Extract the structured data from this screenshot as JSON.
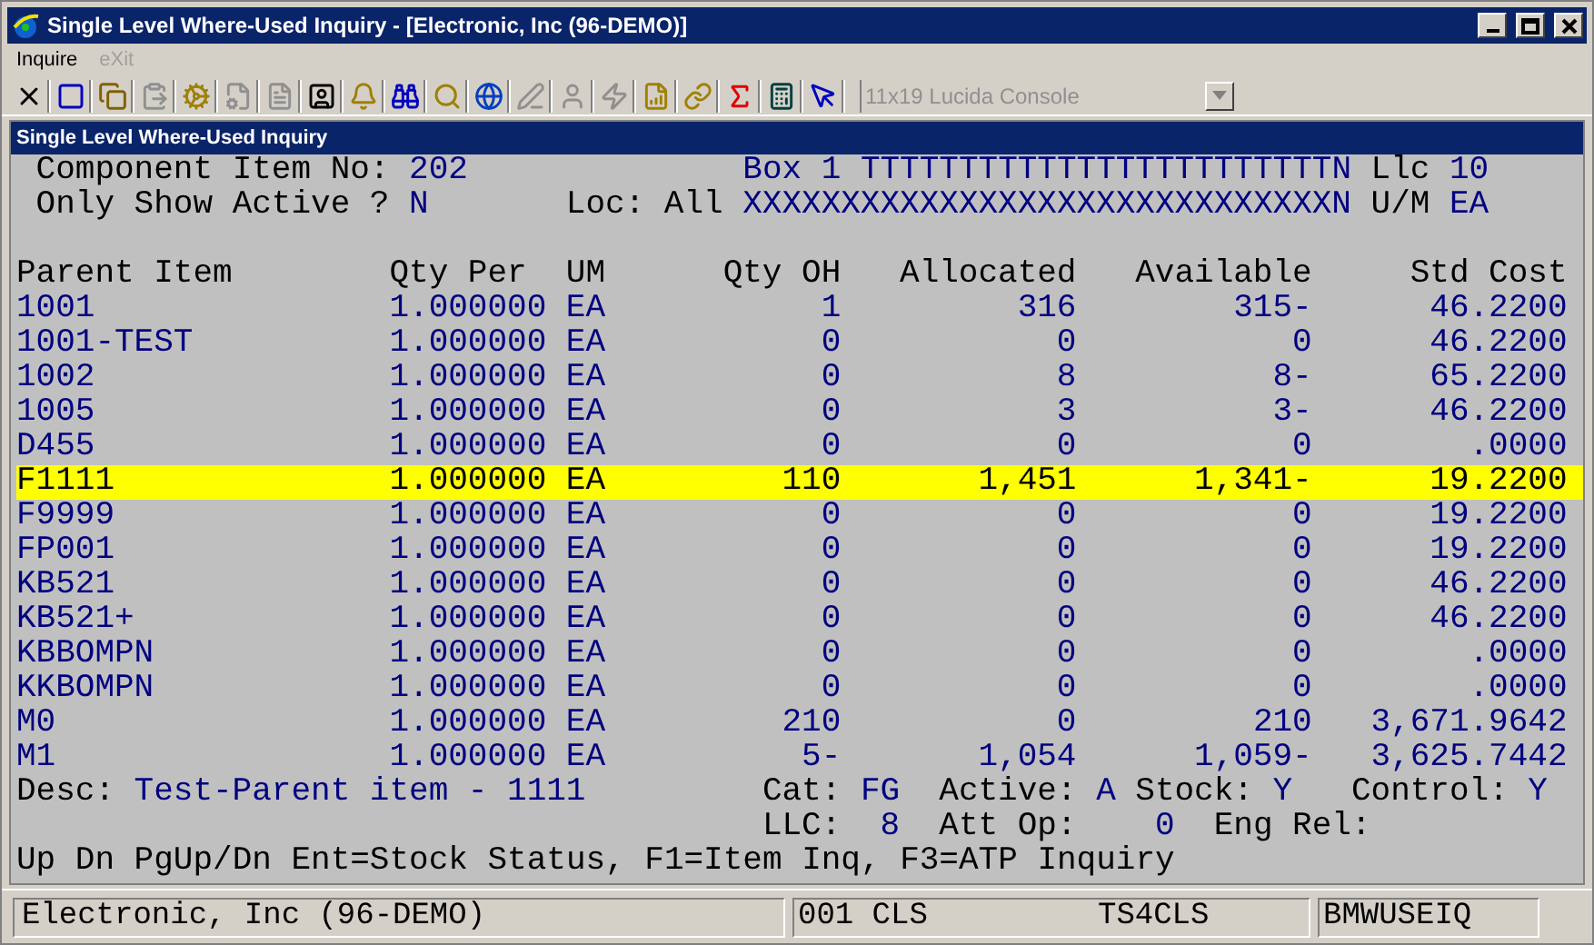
{
  "window": {
    "title": "Single Level Where-Used Inquiry - [Electronic, Inc (96-DEMO)]"
  },
  "menu": [
    {
      "label": "Inquire",
      "disabled": false
    },
    {
      "label": "eXit",
      "disabled": true
    }
  ],
  "toolbar": [
    {
      "disabled": false
    },
    {
      "disabled": false
    },
    {
      "disabled": false
    },
    {
      "disabled": true
    },
    {
      "disabled": false
    },
    {
      "disabled": true
    },
    {
      "disabled": true
    },
    {
      "disabled": false
    },
    {
      "disabled": false
    },
    {
      "disabled": false
    },
    {
      "disabled": false
    },
    {
      "disabled": false
    },
    {
      "disabled": true
    },
    {
      "disabled": true
    },
    {
      "disabled": true
    },
    {
      "disabled": false
    },
    {
      "disabled": false
    },
    {
      "disabled": false
    },
    {
      "disabled": false
    },
    {
      "disabled": false
    }
  ],
  "font_select": {
    "value": "11x19 Lucida Console",
    "disabled": true
  },
  "panel": {
    "title": "Single Level Where-Used Inquiry"
  },
  "header": {
    "component_item": {
      "label": "Component Item No:",
      "value": "202"
    },
    "only_active": {
      "label": "Only Show Active ?",
      "value": "N"
    },
    "loc": {
      "label": "Loc:",
      "value": "All"
    },
    "description_1": "Box 1 TTTTTTTTTTTTTTTTTTTTTTTTN",
    "description_2": "XXXXXXXXXXXXXXXXXXXXXXXXXXXXXXN",
    "llc": {
      "label": "Llc",
      "value": "10"
    },
    "um": {
      "label": "U/M",
      "value": "EA"
    }
  },
  "table": {
    "columns": [
      "Parent Item",
      "Qty Per",
      "UM",
      "Qty OH",
      "Allocated",
      "Available",
      "Std Cost"
    ],
    "rows": [
      {
        "cells": [
          "1001",
          "1.000000",
          "EA",
          "1",
          "316",
          "315-",
          "46.2200"
        ],
        "selected": false
      },
      {
        "cells": [
          "1001-TEST",
          "1.000000",
          "EA",
          "0",
          "0",
          "0",
          "46.2200"
        ],
        "selected": false
      },
      {
        "cells": [
          "1002",
          "1.000000",
          "EA",
          "0",
          "8",
          "8-",
          "65.2200"
        ],
        "selected": false
      },
      {
        "cells": [
          "1005",
          "1.000000",
          "EA",
          "0",
          "3",
          "3-",
          "46.2200"
        ],
        "selected": false
      },
      {
        "cells": [
          "D455",
          "1.000000",
          "EA",
          "0",
          "0",
          "0",
          ".0000"
        ],
        "selected": false
      },
      {
        "cells": [
          "F1111",
          "1.000000",
          "EA",
          "110",
          "1,451",
          "1,341-",
          "19.2200"
        ],
        "selected": true
      },
      {
        "cells": [
          "F9999",
          "1.000000",
          "EA",
          "0",
          "0",
          "0",
          "19.2200"
        ],
        "selected": false
      },
      {
        "cells": [
          "FP001",
          "1.000000",
          "EA",
          "0",
          "0",
          "0",
          "19.2200"
        ],
        "selected": false
      },
      {
        "cells": [
          "KB521",
          "1.000000",
          "EA",
          "0",
          "0",
          "0",
          "46.2200"
        ],
        "selected": false
      },
      {
        "cells": [
          "KB521+",
          "1.000000",
          "EA",
          "0",
          "0",
          "0",
          "46.2200"
        ],
        "selected": false
      },
      {
        "cells": [
          "KBBOMPN",
          "1.000000",
          "EA",
          "0",
          "0",
          "0",
          ".0000"
        ],
        "selected": false
      },
      {
        "cells": [
          "KKBOMPN",
          "1.000000",
          "EA",
          "0",
          "0",
          "0",
          ".0000"
        ],
        "selected": false
      },
      {
        "cells": [
          "M0",
          "1.000000",
          "EA",
          "210",
          "0",
          "210",
          "3,671.9642"
        ],
        "selected": false
      },
      {
        "cells": [
          "M1",
          "1.000000",
          "EA",
          "5-",
          "1,054",
          "1,059-",
          "3,625.7442"
        ],
        "selected": false
      }
    ]
  },
  "details": {
    "desc": {
      "label": "Desc:",
      "value": "Test-Parent item - 1111"
    },
    "cat": {
      "label": "Cat:",
      "value": "FG"
    },
    "active": {
      "label": "Active:",
      "value": "A"
    },
    "stock": {
      "label": "Stock:",
      "value": "Y"
    },
    "control": {
      "label": "Control:",
      "value": "Y"
    },
    "llc": {
      "label": "LLC:",
      "value": "8"
    },
    "att_op": {
      "label": "Att Op:",
      "value": "0"
    },
    "eng_rel": {
      "label": "Eng Rel:"
    }
  },
  "help": "Up Dn PgUp/Dn Ent=Stock Status, F1=Item Inq, F3=ATP Inquiry",
  "status_bar": {
    "company": "Electronic, Inc (96-DEMO)",
    "session": "001 CLS",
    "host": "TS4CLS",
    "program": "BMWUSEIQ"
  }
}
